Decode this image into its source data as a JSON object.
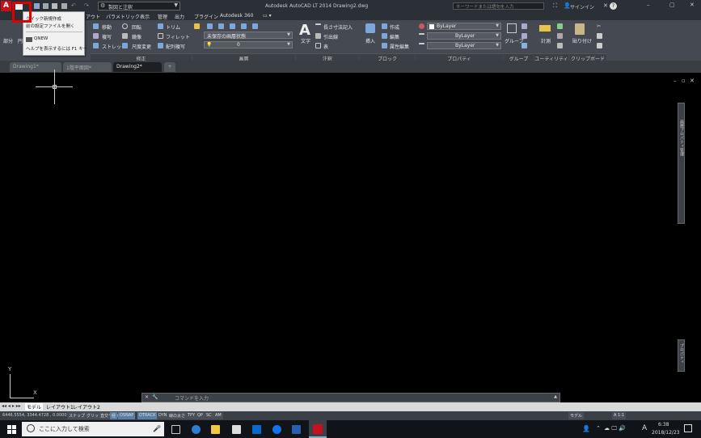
{
  "titlebar": {
    "workspace": "製図と注釈",
    "title": "Autodesk AutoCAD LT 2014   Drawing2.dwg",
    "search_placeholder": "キーワードまたは語句を入力",
    "signin": "サインイン",
    "help": "?"
  },
  "menu": {
    "items": [
      "アウト",
      "パラメトリック",
      "表示",
      "管理",
      "出力",
      "プラグイン",
      "Autodesk 360"
    ]
  },
  "quickmenu": {
    "items": [
      "クイック新規作成",
      "前の設定ファイルを開く",
      "QNEW",
      "ヘルプを表示するには F1 キー"
    ]
  },
  "ribbon": {
    "modify": {
      "label": "修正",
      "items": [
        "移動",
        "回転",
        "トリム",
        "複写",
        "鏡像",
        "フィレット",
        "ストレッチ",
        "尺度変更",
        "配列複写"
      ]
    },
    "layer": {
      "label": "画層",
      "state": "未保存の画層状態",
      "current": "0"
    },
    "annotation": {
      "label": "注釈",
      "text": "文字",
      "dim": "長さ寸法記入",
      "leader": "引出線",
      "table": "表"
    },
    "block": {
      "label": "ブロック",
      "insert": "挿入",
      "create": "作成",
      "edit": "編集",
      "attr": "属性編集"
    },
    "properties": {
      "label": "プロパティ",
      "v1": "ByLayer",
      "v2": "ByLayer",
      "v3": "ByLayer"
    },
    "group": {
      "label": "グループ",
      "btn": "グループ"
    },
    "utility": {
      "label": "ユーティリティ",
      "measure": "計測"
    },
    "clipboard": {
      "label": "クリップボード",
      "paste": "貼り付け"
    },
    "left": {
      "label1": "部分",
      "label2": "円"
    }
  },
  "tabs": [
    "Drawing1*",
    "1階平面図*",
    "Drawing2*"
  ],
  "cmdline": {
    "placeholder": "コマンドを入力"
  },
  "layouts": [
    "モデル",
    "レイアウト1",
    "レイアウト2"
  ],
  "status": {
    "coords": "6446.5554, 3344.4728 , 0.0000",
    "toggles": [
      "スナップ",
      "グリッド",
      "直交モード",
      "極",
      "OSNAP",
      "OTRACK",
      "DYN",
      "線の太さ",
      "TPY",
      "QP",
      "SC",
      "AM"
    ],
    "right": [
      "モデル",
      "A 1:1"
    ]
  },
  "taskbar": {
    "search": "ここに入力して検索",
    "time": "6:38",
    "date": "2018/12/23",
    "ime": "A"
  },
  "rightpanel": {
    "v1": "画層プロパティ管理",
    "v2": "プロパティ"
  },
  "colors": {
    "accent": "#e00000",
    "ribbon": "#454a52",
    "canvas": "#000000"
  }
}
